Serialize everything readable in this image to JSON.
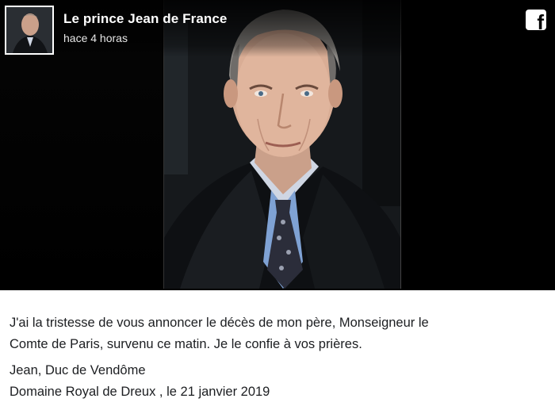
{
  "post": {
    "page_name": "Le prince Jean de France",
    "timestamp": "hace 4 horas",
    "platform_icon": "facebook-icon",
    "message_line1": "J'ai la tristesse de vous annoncer le décès de mon père, Monseigneur le",
    "message_line2": "Comte de Paris, survenu ce matin. Je le confie à vos prières.",
    "signature": "Jean, Duc de Vendôme",
    "place_date": "Domaine Royal de Dreux , le 21 janvier 2019"
  },
  "colors": {
    "media_background": "#000000",
    "text": "#1c1e21",
    "header_text": "#ffffff"
  }
}
